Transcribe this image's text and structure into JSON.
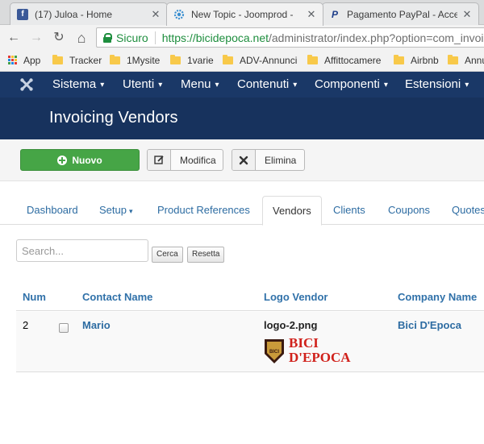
{
  "browser": {
    "tabs": [
      {
        "title": "(17) Juloa - Home",
        "favicon": "facebook-icon"
      },
      {
        "title": "New Topic - Joomprod -",
        "favicon": "joomla-gear-icon",
        "active": true
      },
      {
        "title": "Pagamento PayPal - Acce",
        "favicon": "paypal-icon"
      }
    ],
    "close_glyph": "✕",
    "nav": {
      "back": "←",
      "forward": "→",
      "reload": "↻",
      "home": "⌂"
    },
    "address": {
      "secure_label": "Sicuro",
      "url_host": "https://bicidepoca.net",
      "url_path": "/administrator/index.php?option=com_invoicing&view=vendors"
    },
    "bookmarks": [
      "App",
      "Tracker",
      "1Mysite",
      "1varie",
      "ADV-Annunci",
      "Affittocamere",
      "Airbnb",
      "Annunci"
    ]
  },
  "joomla": {
    "menu": [
      "Sistema",
      "Utenti",
      "Menu",
      "Contenuti",
      "Componenti",
      "Estensioni"
    ],
    "caret": "▾",
    "page_title": "Invoicing Vendors",
    "toolbar": {
      "new": "Nuovo",
      "edit": "Modifica",
      "delete": "Elimina"
    },
    "tabs": [
      "Dashboard",
      "Setup",
      "Product References",
      "Vendors",
      "Clients",
      "Coupons",
      "Quotes"
    ],
    "active_tab": "Vendors",
    "search": {
      "placeholder": "Search...",
      "search_btn": "Cerca",
      "reset_btn": "Resetta"
    },
    "table": {
      "headers": [
        "Num",
        "Contact Name",
        "Logo Vendor",
        "Company Name"
      ],
      "rows": [
        {
          "num": "2",
          "contact": "Mario",
          "logo_file": "logo-2.png",
          "company": "Bici D'Epoca"
        }
      ]
    },
    "logo_text": {
      "line1": "BICI",
      "line2": "D'EPOCA",
      "badge": "BICI"
    }
  },
  "colors": {
    "joomla_menu": "#1a3867",
    "joomla_title": "#17325d",
    "new_button": "#46a546",
    "link": "#2d6ca2",
    "secure": "#1e8e3e",
    "logo_red": "#d0211b"
  }
}
